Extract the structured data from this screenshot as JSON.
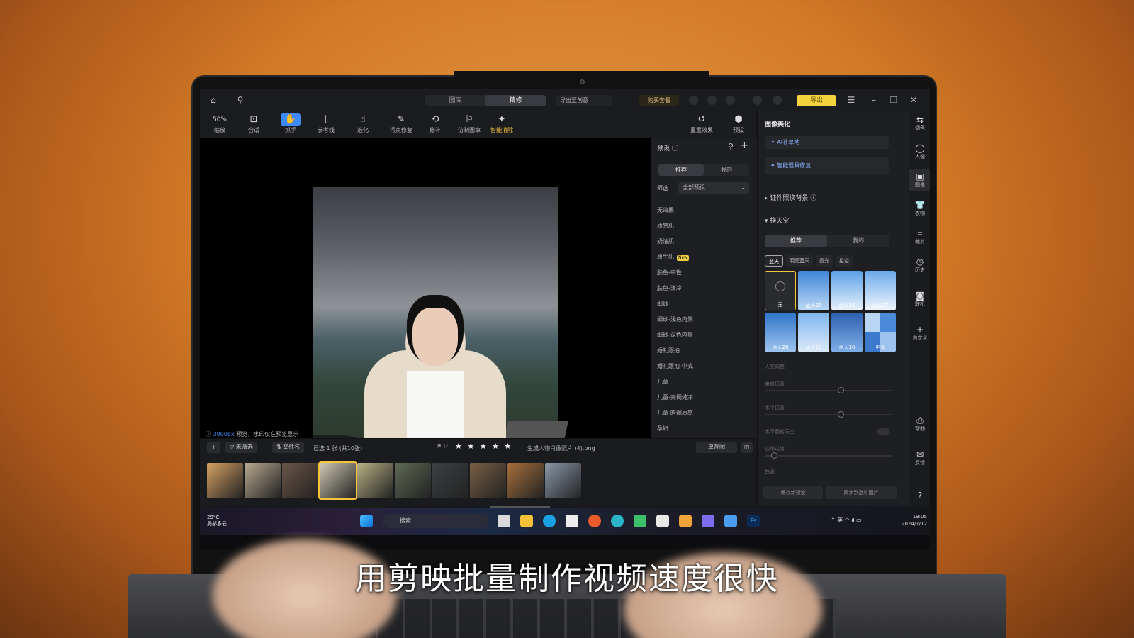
{
  "subtitle": "用剪映批量制作视频速度很快",
  "titlebar": {
    "tabs": [
      {
        "label": "图库",
        "active": false
      },
      {
        "label": "精修",
        "active": true
      }
    ],
    "export_create": "导出至创意",
    "buy": "购买套餐",
    "export": "导出"
  },
  "toolbar": {
    "zoom": "50%",
    "tools": [
      {
        "icon": "zoom-icon",
        "label": "缩放"
      },
      {
        "icon": "fit-icon",
        "label": "合适"
      },
      {
        "icon": "hand-icon",
        "label": "抓手",
        "active": true
      },
      {
        "icon": "guides-icon",
        "label": "参考线"
      },
      {
        "icon": "liquify-icon",
        "label": "液化"
      },
      {
        "icon": "spot-heal-icon",
        "label": "污点修复"
      },
      {
        "icon": "patch-icon",
        "label": "修补"
      },
      {
        "icon": "clone-stamp-icon",
        "label": "仿制图章"
      },
      {
        "icon": "smart-erase-icon",
        "label": "智能消除",
        "accent": true
      }
    ],
    "reset_label": "重置效果",
    "preset_label": "预设"
  },
  "canvas": {
    "hint_px": "3000px",
    "hint_text": "预览，水印仅在预览显示"
  },
  "presets": {
    "header": "预设",
    "tabs": [
      {
        "label": "推荐",
        "active": true
      },
      {
        "label": "我的",
        "active": false
      }
    ],
    "filter_label": "筛选",
    "filter_value": "全部预设",
    "items": [
      "无效果",
      "质感肌",
      "奶油肌",
      "原生肌",
      "肤色-中性",
      "肤色-清冷",
      "细纱",
      "细纱-浅色内景",
      "细纱-深色内景",
      "婚礼跟拍",
      "婚礼跟拍-中式",
      "儿童",
      "儿童-亮调纯净",
      "儿童-暗调质感",
      "孕妇"
    ],
    "new_item": "原生肌",
    "new_tag": "New"
  },
  "strip": {
    "sort_label": "未筛选",
    "name_label": "文件名",
    "selected_info": "已选 1 张 (共10张)",
    "stars": "★ ★ ★ ★ ★",
    "filename": "生成人物肖像照片 (4).png",
    "compare_label": "单视图",
    "thumb_colors": [
      "#d6a163",
      "#b8aa8e",
      "#6b5548",
      "#cfc8b3",
      "#b7b284",
      "#5f6a55",
      "#3c4145",
      "#7a5f44",
      "#a86f3c",
      "#8a98a8"
    ],
    "selected_index": 3
  },
  "right_panel": {
    "title": "图像美化",
    "feature1": "AI补草地",
    "feature2": "智能道具修复",
    "section1": "证件照换背景",
    "section2": "换天空",
    "tabs": [
      {
        "label": "推荐",
        "active": true
      },
      {
        "label": "我的",
        "active": false
      }
    ],
    "chips": [
      {
        "label": "蓝天",
        "active": true
      },
      {
        "label": "明亮蓝天",
        "active": false
      },
      {
        "label": "霞光",
        "active": false
      },
      {
        "label": "星空",
        "active": false
      }
    ],
    "skies": [
      "无",
      "蓝天25",
      "蓝天26",
      "蓝天27",
      "蓝天28",
      "蓝天29",
      "蓝天30",
      "更多"
    ],
    "sliders": [
      {
        "label": "天空调整"
      },
      {
        "label": "垂直位置",
        "value": 0.6
      },
      {
        "label": "水平位置",
        "value": 0.6
      },
      {
        "label": "水平翻转天空"
      },
      {
        "label": "边缘过渡",
        "value": 0.05
      },
      {
        "label": "色温"
      }
    ],
    "save_btn": "保存新预设",
    "sync_btn": "同步到选中图片"
  },
  "rail": [
    {
      "icon": "adjust-icon",
      "label": "调色"
    },
    {
      "icon": "portrait-icon",
      "label": "人像"
    },
    {
      "icon": "image-icon",
      "label": "图像",
      "active": true
    },
    {
      "icon": "clothes-icon",
      "label": "衣物"
    },
    {
      "icon": "crop-icon",
      "label": "裁剪"
    },
    {
      "icon": "history-icon",
      "label": "历史"
    },
    {
      "icon": "tether-icon",
      "label": "联机"
    },
    {
      "icon": "plus-icon",
      "label": "自定义"
    },
    {
      "icon": "help-icon",
      "label": "帮助"
    },
    {
      "icon": "feedback-icon",
      "label": "反馈"
    }
  ],
  "taskbar": {
    "temp": "29°C",
    "weather": "局部多云",
    "search": "搜索",
    "ime": "英",
    "time": "19:05",
    "date": "2024/7/12"
  }
}
